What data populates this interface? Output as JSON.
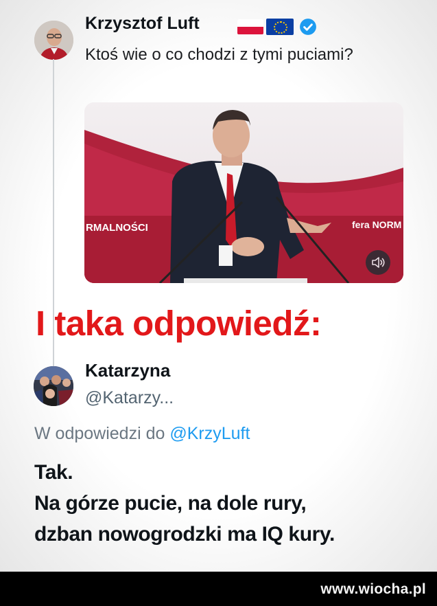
{
  "post": {
    "author_name": "Krzysztof Luft",
    "verified": true,
    "flags": [
      "poland-flag",
      "eu-flag"
    ],
    "text": "Ktoś wie o co chodzi z tymi puciami?",
    "video": {
      "backdrop_left_text": "RMALNOŚCI",
      "backdrop_right_text": "fera NORM",
      "volume_icon": "speaker-icon"
    }
  },
  "headline": "I taka odpowiedź:",
  "reply": {
    "author_name": "Katarzyna",
    "handle": "@Katarzy...",
    "in_reply_to_prefix": "W odpowiedzi do ",
    "in_reply_to_mention": "@KrzyLuft",
    "lines": [
      "Tak.",
      "Na górze pucie, na dole rury,",
      "dzban nowogrodzki ma IQ kury."
    ]
  },
  "watermark": "www.wiocha.pl",
  "colors": {
    "headline": "#e2181a",
    "mention": "#1d9bf0",
    "verified": "#1d9bf0",
    "footer_bg": "#000000"
  }
}
